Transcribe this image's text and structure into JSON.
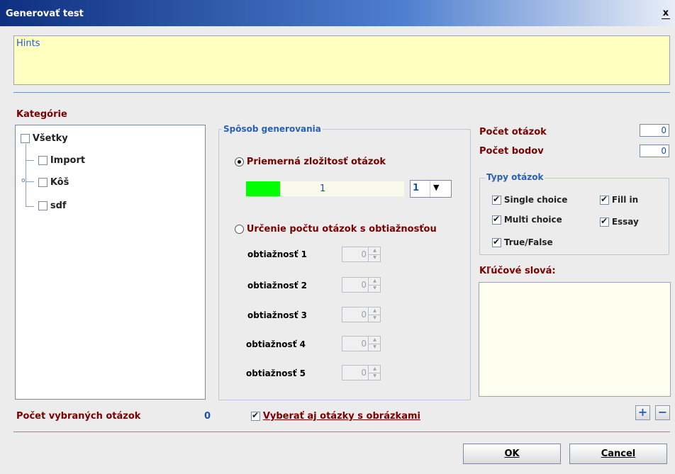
{
  "window": {
    "title": "Generovať test",
    "close_glyph": "x"
  },
  "hints": {
    "text": "Hints"
  },
  "categories": {
    "label": "Kategórie",
    "items": [
      {
        "label": "Všetky",
        "checked": false
      },
      {
        "label": "Import",
        "checked": false
      },
      {
        "label": "Kôš",
        "checked": false
      },
      {
        "label": "sdf",
        "checked": false
      }
    ]
  },
  "generation": {
    "title": "Spôsob generovania",
    "option_avg": "Priemerná zložitosť otázok",
    "avg_selected": true,
    "slider_value": "1",
    "combo_value": "1",
    "option_count": "Určenie počtu otázok s obtiažnosťou",
    "difficulties": [
      {
        "label": "obtiažnosť 1",
        "value": "0"
      },
      {
        "label": "obtiažnosť 2",
        "value": "0"
      },
      {
        "label": "obtiažnosť 3",
        "value": "0"
      },
      {
        "label": "obtiažnosť 4",
        "value": "0"
      },
      {
        "label": "obtiažnosť 5",
        "value": "0"
      }
    ]
  },
  "counts": {
    "questions_label": "Počet otázok",
    "questions_value": "0",
    "points_label": "Počet bodov",
    "points_value": "0"
  },
  "types": {
    "title": "Typy otázok",
    "single_choice": "Single choice",
    "fill_in": "Fill in",
    "multi_choice": "Multi choice",
    "essay": "Essay",
    "true_false": "True/False"
  },
  "keywords": {
    "label": "Kľúčové slová:"
  },
  "footer": {
    "selected_label": "Počet vybraných otázok",
    "selected_value": "0",
    "with_images_label": "Vyberať aj otázky s obrázkami",
    "ok": "OK",
    "cancel": "Cancel"
  },
  "colors": {
    "title_gradient_start": "#0f2f80",
    "hints_bg": "#ffffc0",
    "label_red": "#7a0000",
    "accent_blue": "#2a5fb8",
    "slider_fill": "#00ff00"
  }
}
